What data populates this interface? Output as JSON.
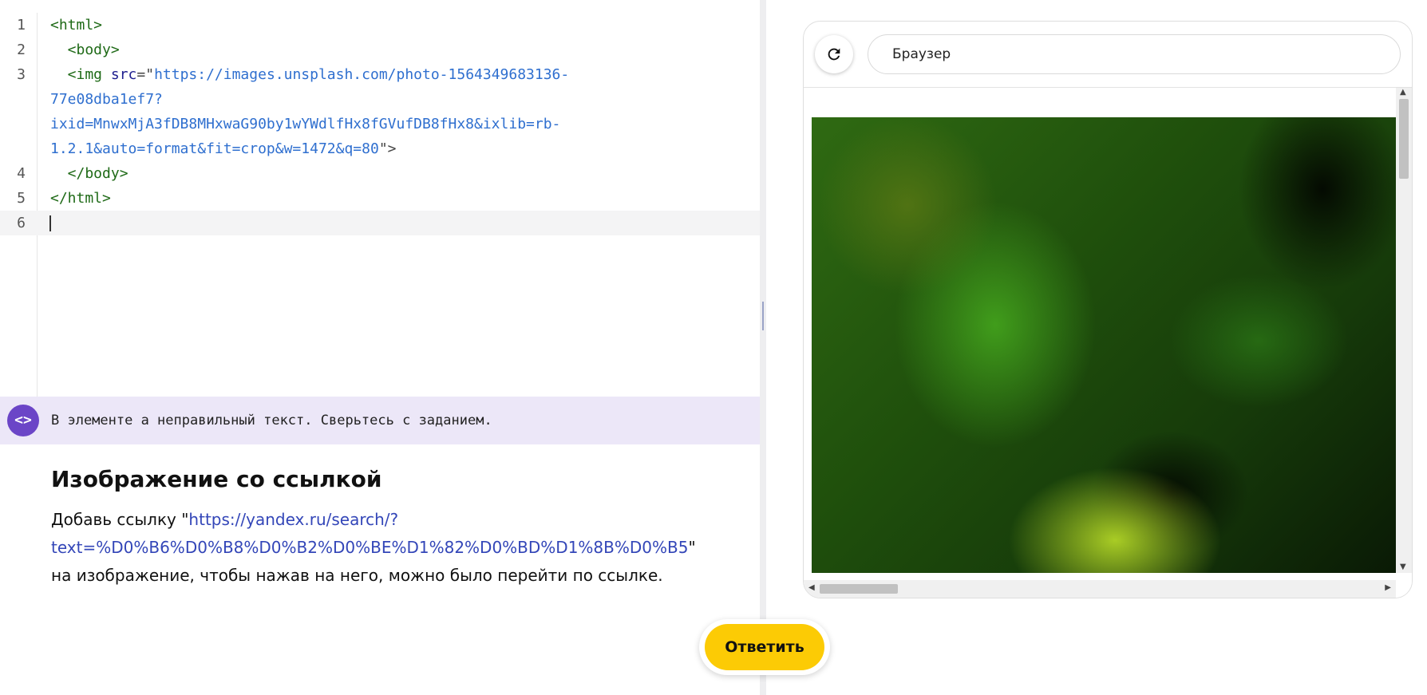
{
  "editor": {
    "lines": [
      {
        "num": "1",
        "tag_open": "<html>"
      },
      {
        "num": "2",
        "tag_open": "  <body>"
      },
      {
        "num": "3",
        "img_prefix": "  <img ",
        "attr_name": "src",
        "eq": "=\"",
        "url_1": "https://images.unsplash.com/photo-1564349683136-",
        "url_2": "77e08dba1ef7?",
        "url_3": "ixid=MnwxMjA3fDB8MHxwaG90by1wYWdlfHx8fGVufDB8fHx8&ixlib=rb-",
        "url_4": "1.2.1&auto=format&fit=crop&w=1472&q=80",
        "close": "\">"
      },
      {
        "num": "4",
        "tag_close": "  </body>"
      },
      {
        "num": "5",
        "tag_close": "</html>"
      },
      {
        "num": "6"
      }
    ]
  },
  "error": {
    "icon": "<>",
    "message": "В элементе a неправильный текст. Сверьтесь с заданием."
  },
  "task": {
    "title": "Изображение со ссылкой",
    "desc_before": "Добавь ссылку \"",
    "link": "https://yandex.ru/search/?text=%D0%B6%D0%B8%D0%B2%D0%BE%D1%82%D0%BD%D1%8B%D0%B5",
    "desc_after": "\" на изображение, чтобы нажав на него, можно было перейти по ссылке."
  },
  "browser": {
    "address": "Браузер",
    "reload_icon": "reload-icon"
  },
  "answer_button": {
    "label": "Ответить",
    "color": "#fccb05"
  },
  "colors": {
    "accent": "#6b45c7",
    "error_bg": "#ece7f8",
    "link": "#3346b8"
  }
}
